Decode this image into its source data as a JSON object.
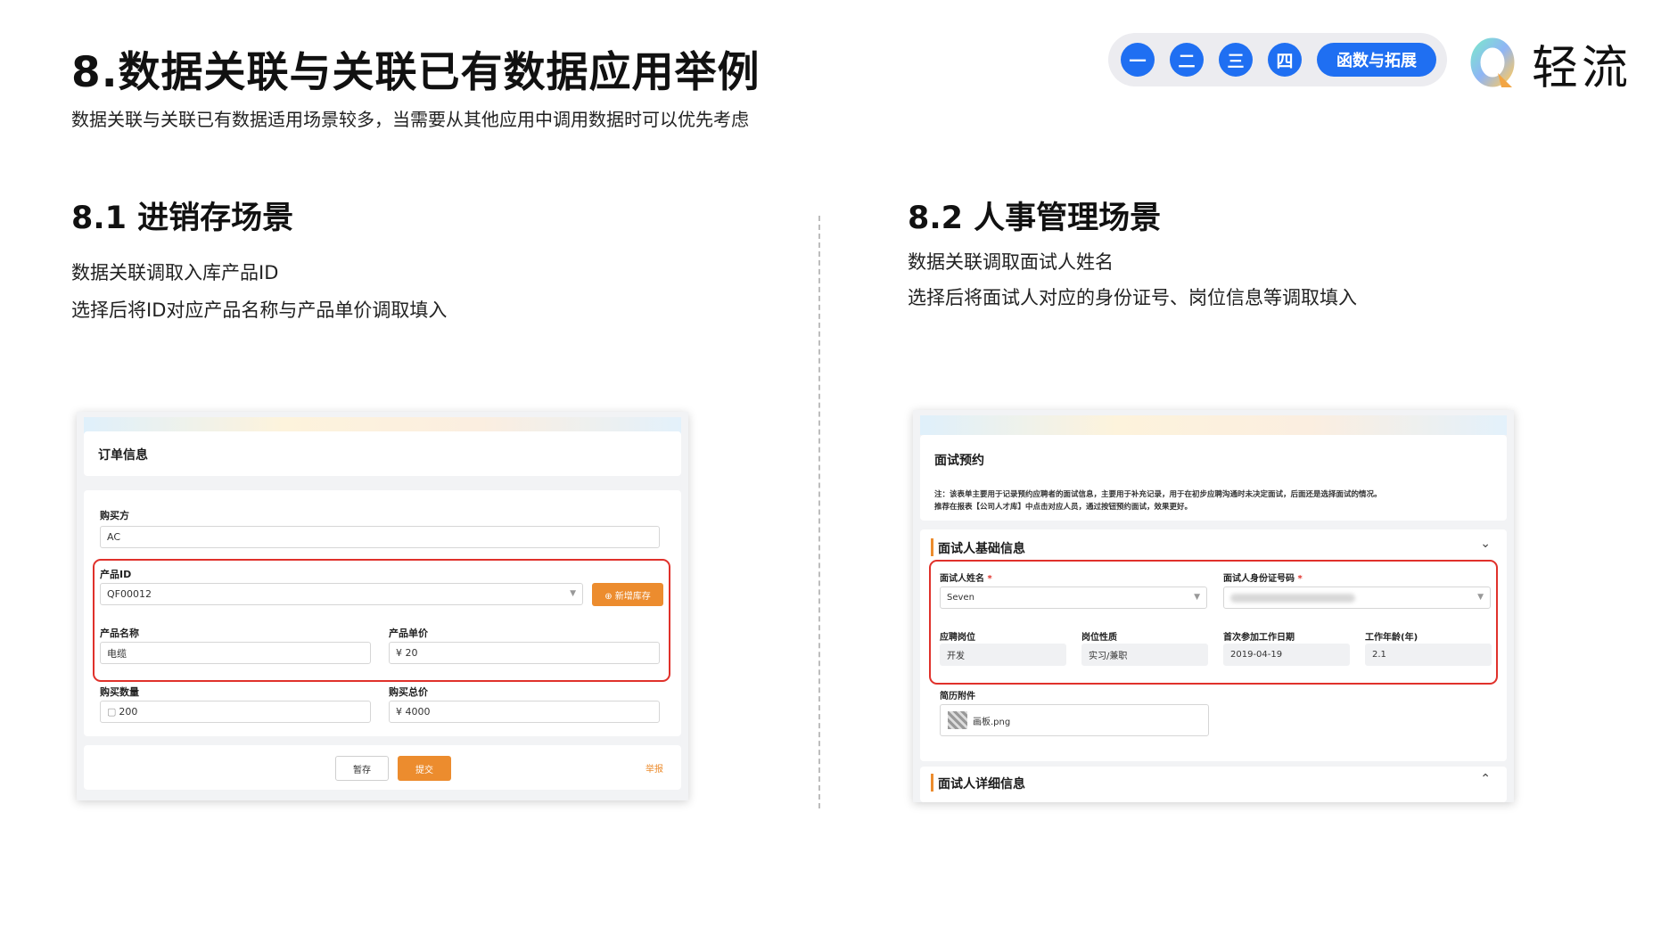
{
  "header": {
    "title": "8.数据关联与关联已有数据应用举例",
    "subtitle": "数据关联与关联已有数据适用场景较多，当需要从其他应用中调用数据时可以优先考虑"
  },
  "chapter_nav": {
    "items": [
      "一",
      "二",
      "三",
      "四"
    ],
    "active_label": "函数与拓展"
  },
  "logo": {
    "text": "轻流"
  },
  "colors": {
    "accent_blue": "#1f6ff2",
    "accent_orange": "#ec8c2e",
    "highlight_red": "#e0312b"
  },
  "section1": {
    "title": "8.1 进销存场景",
    "desc_line1": "数据关联调取入库产品ID",
    "desc_line2": "选择后将ID对应产品名称与产品单价调取填入",
    "form": {
      "card_title": "订单信息",
      "buyer_label": "购买方",
      "buyer_value": "AC",
      "product_id_label": "产品ID",
      "product_id_value": "QF00012",
      "add_stock_button": "⊕ 新增库存",
      "product_name_label": "产品名称",
      "product_name_value": "电缆",
      "unit_price_label": "产品单价",
      "unit_price_value": "¥ 20",
      "qty_label": "购买数量",
      "qty_value": "200",
      "total_label": "购买总价",
      "total_value": "¥ 4000",
      "save_draft_button": "暂存",
      "submit_button": "提交",
      "report_link": "举报"
    }
  },
  "section2": {
    "title": "8.2 人事管理场景",
    "desc_line1": "数据关联调取面试人姓名",
    "desc_line2": "选择后将面试人对应的身份证号、岗位信息等调取填入",
    "form": {
      "card_title": "面试预约",
      "note_line1": "注：该表单主要用于记录预约应聘者的面试信息，主要用于补充记录，用于在初步应聘沟通时未决定面试，后面还是选择面试的情况。",
      "note_line2": "推荐在报表【公司人才库】中点击对应人员，通过按钮预约面试，效果更好。",
      "basic_section_title": "面试人基础信息",
      "name_label": "面试人姓名",
      "name_value": "Seven",
      "id_label": "面试人身份证号码",
      "position_label": "应聘岗位",
      "position_value": "开发",
      "nature_label": "岗位性质",
      "nature_value": "实习/兼职",
      "first_work_label": "首次参加工作日期",
      "first_work_value": "2019-04-19",
      "years_label": "工作年龄(年)",
      "years_value": "2.1",
      "resume_label": "简历附件",
      "resume_file": "画板.png",
      "detail_section_title": "面试人详细信息"
    }
  }
}
